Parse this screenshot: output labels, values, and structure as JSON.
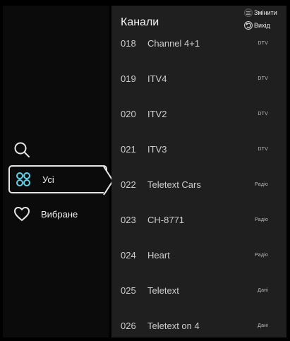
{
  "sidebar": {
    "search_icon": "search-icon",
    "items": [
      {
        "label": "Усі",
        "icon": "grid-clover-icon",
        "selected": true,
        "icon_color": "#5fd2e6"
      },
      {
        "label": "Вибране",
        "icon": "heart-icon",
        "selected": false
      }
    ]
  },
  "panel": {
    "title": "Канали",
    "hints": {
      "change": "Змінити",
      "exit": "Вихід"
    }
  },
  "channels": [
    {
      "number": "018",
      "name": "Channel 4+1",
      "type": "DTV"
    },
    {
      "number": "019",
      "name": "ITV4",
      "type": "DTV"
    },
    {
      "number": "020",
      "name": "ITV2",
      "type": "DTV"
    },
    {
      "number": "021",
      "name": "ITV3",
      "type": "DTV"
    },
    {
      "number": "022",
      "name": "Teletext Cars",
      "type": "Радіо"
    },
    {
      "number": "023",
      "name": "CH-8771",
      "type": "Радіо"
    },
    {
      "number": "024",
      "name": "Heart",
      "type": "Радіо"
    },
    {
      "number": "025",
      "name": "Teletext",
      "type": "Дані"
    },
    {
      "number": "026",
      "name": "Teletext on 4",
      "type": "Дані"
    }
  ]
}
